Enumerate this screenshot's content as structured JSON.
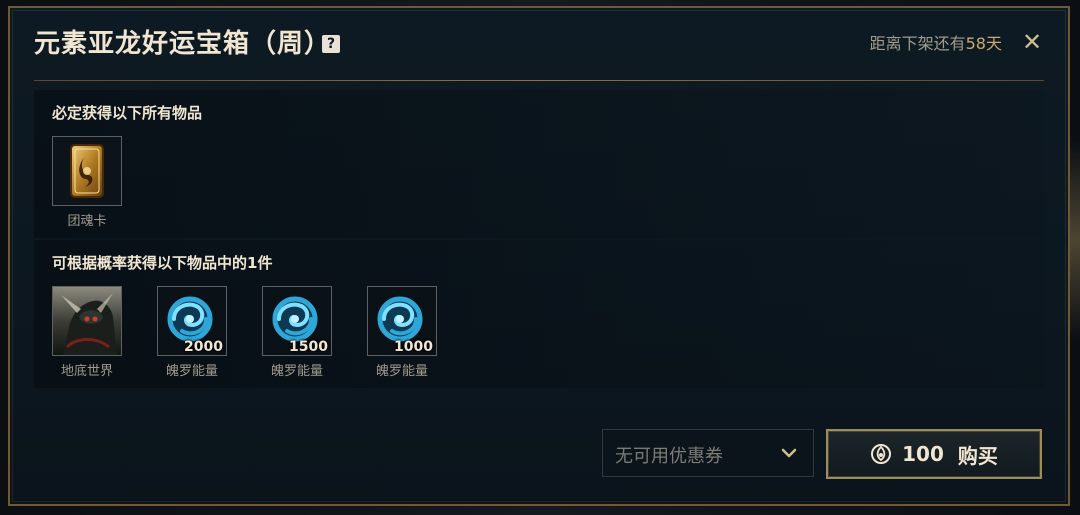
{
  "dialog": {
    "title": "元素亚龙好运宝箱（周）",
    "help_glyph": "?",
    "expiry_prefix": "距离下架还有",
    "expiry_days": "58天",
    "close_glyph": "✕"
  },
  "guaranteed": {
    "title": "必定获得以下所有物品",
    "items": [
      {
        "label": "团魂卡",
        "icon": "soul-card-icon"
      }
    ]
  },
  "chance": {
    "title": "可根据概率获得以下物品中的1件",
    "items": [
      {
        "label": "地底世界",
        "icon": "skin-portrait-icon",
        "qty": ""
      },
      {
        "label": "魄罗能量",
        "icon": "poro-energy-icon",
        "qty": "2000"
      },
      {
        "label": "魄罗能量",
        "icon": "poro-energy-icon",
        "qty": "1500"
      },
      {
        "label": "魄罗能量",
        "icon": "poro-energy-icon",
        "qty": "1000"
      }
    ]
  },
  "footer": {
    "coupon_text": "无可用优惠券",
    "price": "100",
    "buy_label": "购买"
  },
  "colors": {
    "gold": "#c8aa6e",
    "text": "#f0e6d2",
    "muted": "#a09b8c",
    "border_gold": "#6f5a33",
    "energy_blue": "#2fa6d8"
  }
}
